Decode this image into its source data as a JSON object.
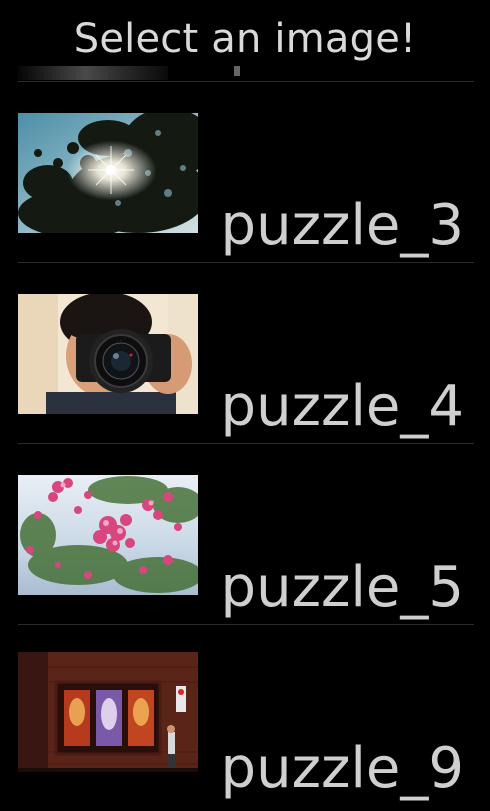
{
  "header": {
    "title": "Select an image!"
  },
  "items": [
    {
      "label": "puzzle_3",
      "thumbnail": "sun-through-tree"
    },
    {
      "label": "puzzle_4",
      "thumbnail": "person-with-camera"
    },
    {
      "label": "puzzle_5",
      "thumbnail": "pink-flowers"
    },
    {
      "label": "puzzle_9",
      "thumbnail": "theater-posters-building"
    }
  ],
  "colors": {
    "background": "#000000",
    "text": "#cfcfcf",
    "divider": "#2a2a2a"
  }
}
